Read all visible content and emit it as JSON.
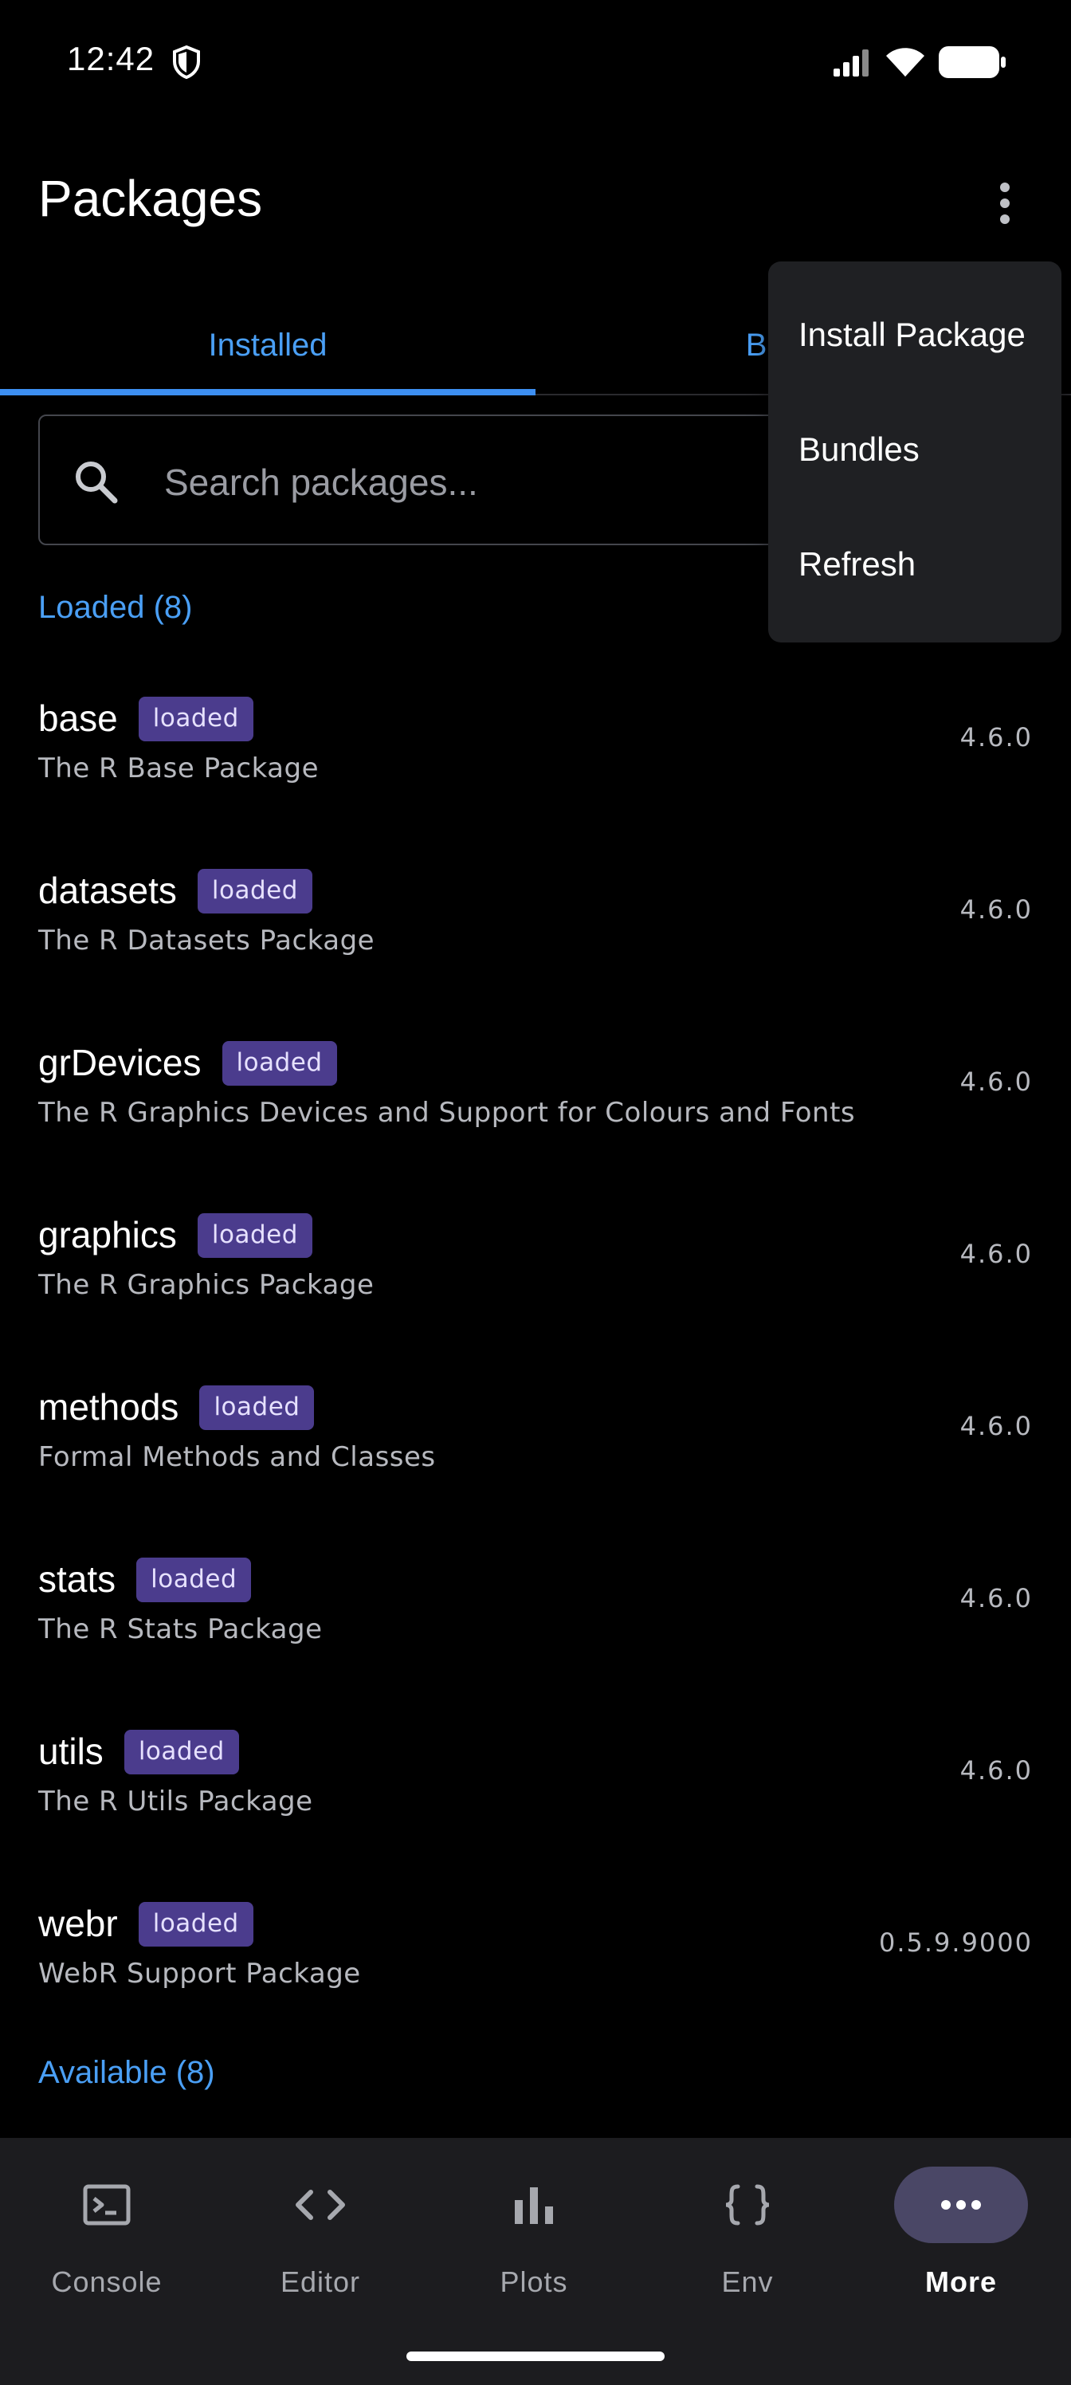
{
  "status_bar": {
    "time": "12:42"
  },
  "app_bar": {
    "title": "Packages"
  },
  "tabs": [
    {
      "label": "Installed",
      "active": true
    },
    {
      "label": "Bundles",
      "active": false
    }
  ],
  "search": {
    "placeholder": "Search packages..."
  },
  "sections": {
    "loaded": "Loaded (8)",
    "available": "Available (8)"
  },
  "packages": [
    {
      "name": "base",
      "badge": "loaded",
      "description": "The R Base Package",
      "version": "4.6.0"
    },
    {
      "name": "datasets",
      "badge": "loaded",
      "description": "The R Datasets Package",
      "version": "4.6.0"
    },
    {
      "name": "grDevices",
      "badge": "loaded",
      "description": "The R Graphics Devices and Support for Colours and Fonts",
      "version": "4.6.0"
    },
    {
      "name": "graphics",
      "badge": "loaded",
      "description": "The R Graphics Package",
      "version": "4.6.0"
    },
    {
      "name": "methods",
      "badge": "loaded",
      "description": "Formal Methods and Classes",
      "version": "4.6.0"
    },
    {
      "name": "stats",
      "badge": "loaded",
      "description": "The R Stats Package",
      "version": "4.6.0"
    },
    {
      "name": "utils",
      "badge": "loaded",
      "description": "The R Utils Package",
      "version": "4.6.0"
    },
    {
      "name": "webr",
      "badge": "loaded",
      "description": "WebR Support Package",
      "version": "0.5.9.9000"
    }
  ],
  "overflow_menu": {
    "items": [
      "Install Package",
      "Bundles",
      "Refresh"
    ]
  },
  "bottom_nav": {
    "items": [
      {
        "label": "Console",
        "icon": "terminal-icon",
        "active": false
      },
      {
        "label": "Editor",
        "icon": "code-icon",
        "active": false
      },
      {
        "label": "Plots",
        "icon": "bar-chart-icon",
        "active": false
      },
      {
        "label": "Env",
        "icon": "braces-icon",
        "active": false
      },
      {
        "label": "More",
        "icon": "more-horizontal-icon",
        "active": true
      }
    ]
  },
  "colors": {
    "accent": "#4a9ff5",
    "badge_bg": "#4b3c8d",
    "menu_bg": "#1f2023",
    "nav_bg": "#1c1c1f",
    "nav_active_pill": "#4a4766"
  }
}
